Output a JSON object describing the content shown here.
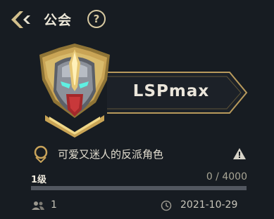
{
  "header": {
    "title": "公会",
    "help_label": "?",
    "back_icon": "chevron-left-icon",
    "help_icon": "question-circle-icon"
  },
  "guild": {
    "emblem_icon": "helmet-crest-icon",
    "name": "LSPmax",
    "description": "可爱又迷人的反派角色",
    "description_icon": "badge-ring-icon",
    "report_icon": "warning-triangle-icon",
    "level": "1级",
    "xp_current": "0",
    "xp_separator": " / ",
    "xp_max": "4000",
    "xp_progress": 0,
    "member_count": "1",
    "member_icon": "people-icon",
    "created_date": "2021-10-29",
    "date_icon": "clock-icon"
  },
  "colors": {
    "background": "#171c22",
    "gold": "#c8a35a",
    "banner": "#1b2027",
    "text": "#ebe6db"
  }
}
